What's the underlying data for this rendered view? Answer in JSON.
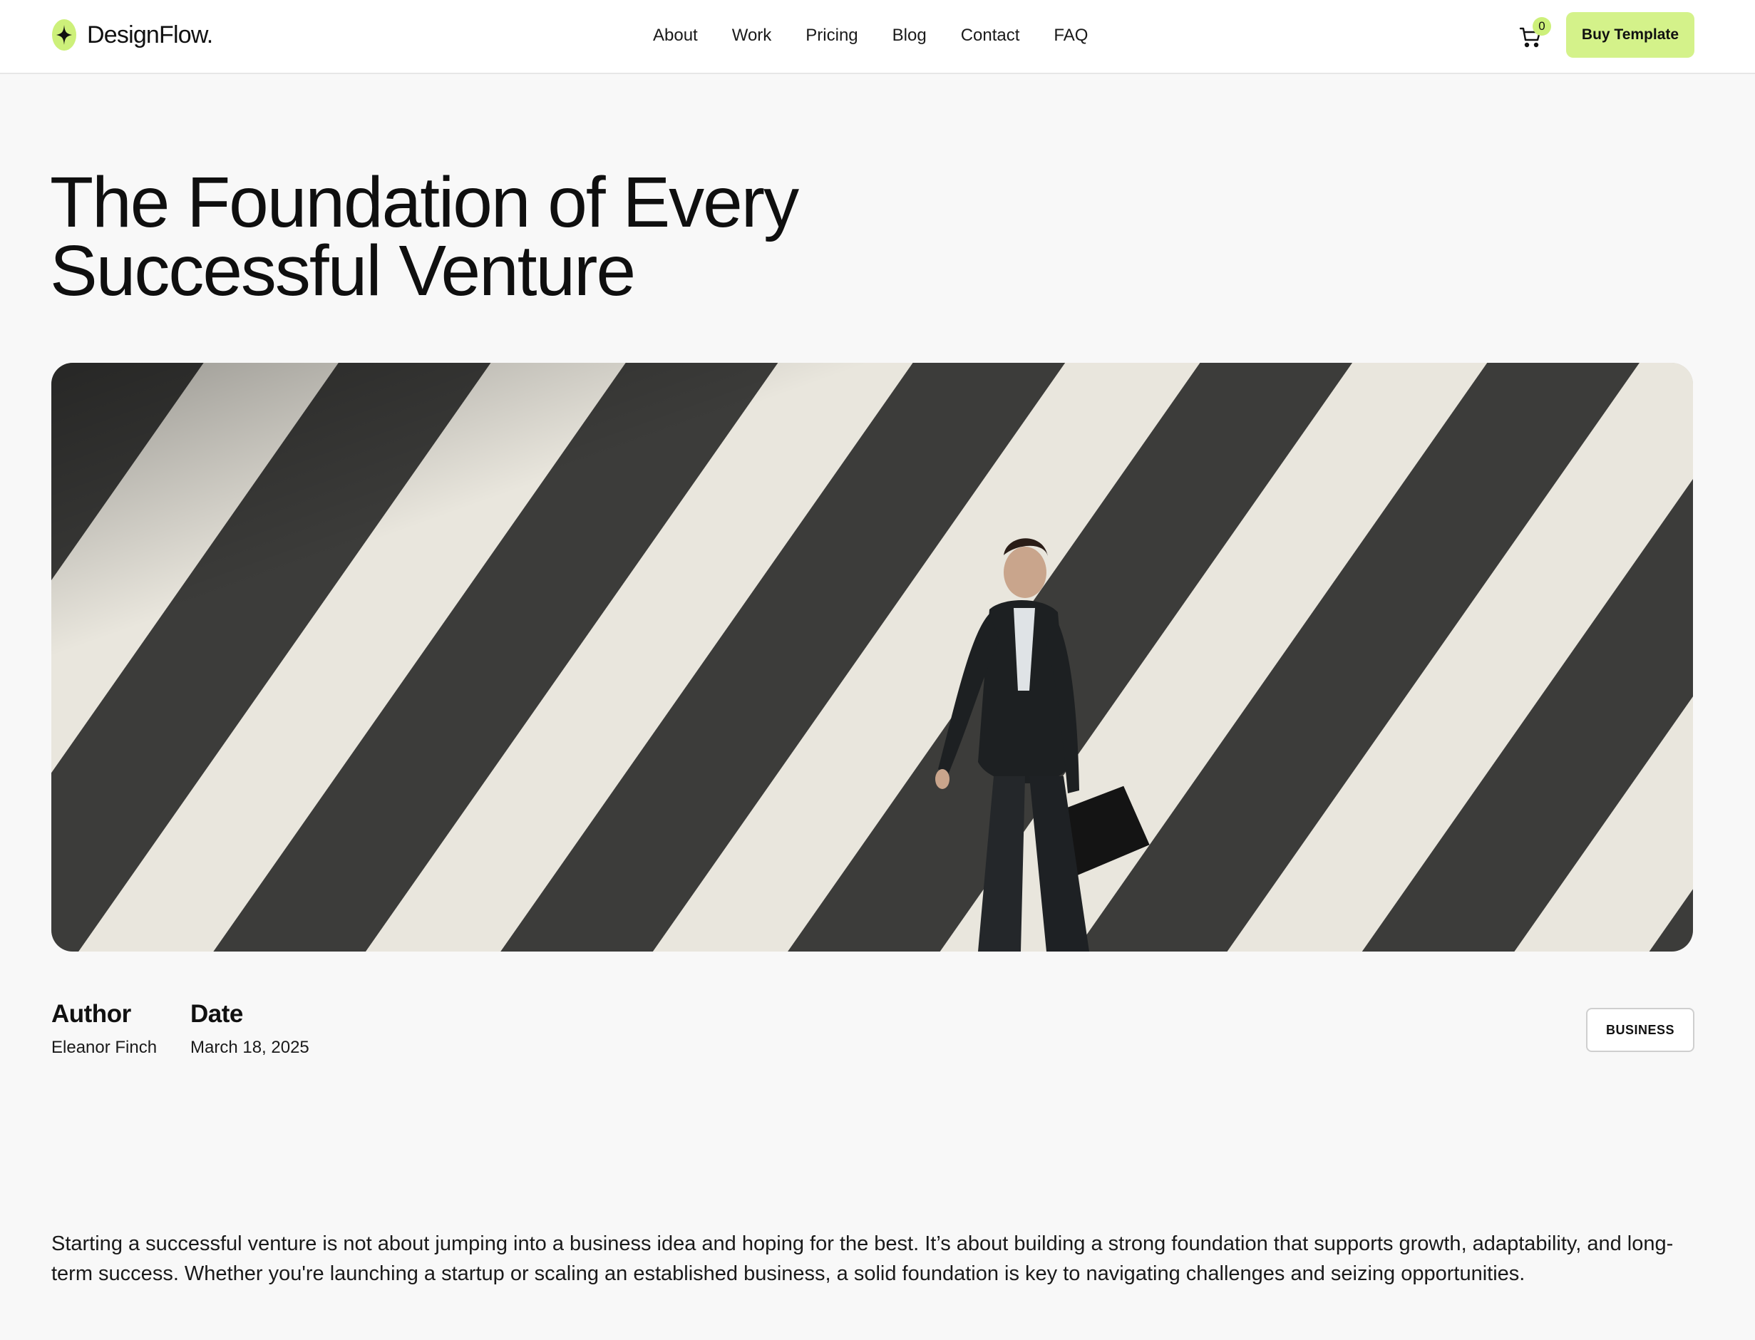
{
  "header": {
    "brand": "DesignFlow.",
    "logo_icon": "sparkle-icon",
    "nav": [
      {
        "label": "About"
      },
      {
        "label": "Work"
      },
      {
        "label": "Pricing"
      },
      {
        "label": "Blog"
      },
      {
        "label": "Contact"
      },
      {
        "label": "FAQ"
      }
    ],
    "cart_icon": "cart-icon",
    "cart_count": "0",
    "cta_label": "Buy Template"
  },
  "article": {
    "title_line1": "The Foundation of Every",
    "title_line2": "Successful Venture",
    "hero_image": "aerial-crosswalk-businessman-photo",
    "author_label": "Author",
    "author_name": "Eleanor Finch",
    "date_label": "Date",
    "date_value": "March 18, 2025",
    "category": "BUSINESS",
    "intro": "Starting a successful venture is not about jumping into a business idea and hoping for the best. It’s about building a strong foundation that supports growth, adaptability, and long-term success. Whether you're launching a startup or scaling an established business, a solid foundation is key to navigating challenges and seizing opportunities."
  },
  "colors": {
    "accent": "#d4f28a",
    "background": "#f8f8f8",
    "text": "#111111",
    "asphalt": "#3a3a38",
    "stripe": "#e9e6dd"
  }
}
